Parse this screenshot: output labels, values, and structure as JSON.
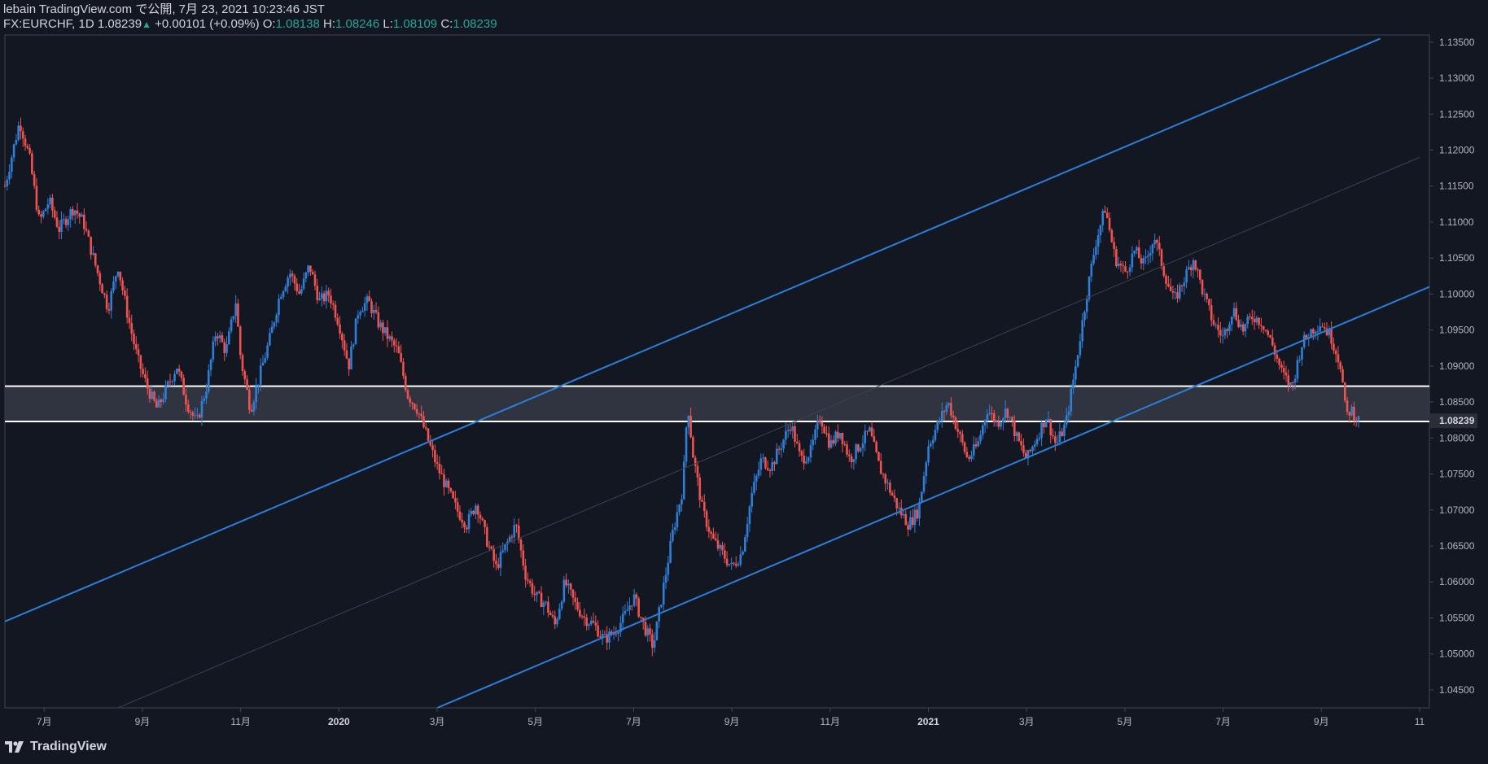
{
  "header": {
    "publisher": "lebain TradingView.com で公開, 7月 23, 2021 10:23:46 JST",
    "symbol_line": "FX:EURCHF, 1D 1.08239",
    "change": "+0.00101 (+0.09%)",
    "o_label": "O:",
    "o_value": "1.08138",
    "h_label": "H:",
    "h_value": "1.08246",
    "l_label": "L:",
    "l_value": "1.08109",
    "c_label": "C:",
    "c_value": "1.08239"
  },
  "footer": {
    "brand": "TradingView",
    "logo_icon": "tradingview-logo-icon"
  },
  "colors": {
    "background": "#131722",
    "up": "#2f7fd6",
    "down": "#ef5350",
    "trendline": "#2b7fd8",
    "zone": "#363a45",
    "zone_border": "#ffffff"
  },
  "chart_data": {
    "type": "candlestick",
    "symbol": "FX:EURCHF",
    "interval": "1D",
    "ylim": [
      1.0425,
      1.136
    ],
    "y_ticks": [
      "1.13500",
      "1.13000",
      "1.12500",
      "1.12000",
      "1.11500",
      "1.11000",
      "1.10500",
      "1.10000",
      "1.09500",
      "1.09000",
      "1.08500",
      "1.08000",
      "1.07500",
      "1.07000",
      "1.06500",
      "1.06000",
      "1.05500",
      "1.05000",
      "1.04500"
    ],
    "x_ticks": [
      {
        "label": "7月",
        "t": 0.3,
        "bold": false
      },
      {
        "label": "9月",
        "t": 2.3,
        "bold": false
      },
      {
        "label": "11月",
        "t": 4.3,
        "bold": false
      },
      {
        "label": "2020",
        "t": 6.3,
        "bold": true
      },
      {
        "label": "3月",
        "t": 8.3,
        "bold": false
      },
      {
        "label": "5月",
        "t": 10.3,
        "bold": false
      },
      {
        "label": "7月",
        "t": 12.3,
        "bold": false
      },
      {
        "label": "9月",
        "t": 14.3,
        "bold": false
      },
      {
        "label": "11月",
        "t": 16.3,
        "bold": false
      },
      {
        "label": "2021",
        "t": 18.3,
        "bold": true
      },
      {
        "label": "3月",
        "t": 20.3,
        "bold": false
      },
      {
        "label": "5月",
        "t": 22.3,
        "bold": false
      },
      {
        "label": "7月",
        "t": 24.3,
        "bold": false
      },
      {
        "label": "9月",
        "t": 26.3,
        "bold": false
      },
      {
        "label": "11",
        "t": 28.3,
        "bold": false
      }
    ],
    "x_range": [
      -0.5,
      28.5
    ],
    "last_price": "1.08239",
    "support_zone": {
      "lower": 1.0823,
      "upper": 1.0872
    },
    "channel": {
      "upper": [
        {
          "t": -0.5,
          "p": 1.0545
        },
        {
          "t": 27.5,
          "p": 1.1355
        }
      ],
      "lower": [
        {
          "t": 8.3,
          "p": 1.0425
        },
        {
          "t": 28.5,
          "p": 1.101
        }
      ],
      "middle": [
        {
          "t": 1.8,
          "p": 1.0425
        },
        {
          "t": 28.3,
          "p": 1.119
        }
      ]
    },
    "series_path": [
      {
        "t": -0.5,
        "p": 1.115
      },
      {
        "t": -0.3,
        "p": 1.121
      },
      {
        "t": -0.2,
        "p": 1.124
      },
      {
        "t": 0.0,
        "p": 1.119
      },
      {
        "t": 0.2,
        "p": 1.11
      },
      {
        "t": 0.4,
        "p": 1.113
      },
      {
        "t": 0.6,
        "p": 1.109
      },
      {
        "t": 0.9,
        "p": 1.112
      },
      {
        "t": 1.1,
        "p": 1.11
      },
      {
        "t": 1.3,
        "p": 1.105
      },
      {
        "t": 1.6,
        "p": 1.098
      },
      {
        "t": 1.8,
        "p": 1.104
      },
      {
        "t": 2.0,
        "p": 1.097
      },
      {
        "t": 2.2,
        "p": 1.091
      },
      {
        "t": 2.4,
        "p": 1.087
      },
      {
        "t": 2.6,
        "p": 1.084
      },
      {
        "t": 2.8,
        "p": 1.087
      },
      {
        "t": 3.0,
        "p": 1.09
      },
      {
        "t": 3.2,
        "p": 1.085
      },
      {
        "t": 3.4,
        "p": 1.082
      },
      {
        "t": 3.6,
        "p": 1.087
      },
      {
        "t": 3.8,
        "p": 1.095
      },
      {
        "t": 4.0,
        "p": 1.092
      },
      {
        "t": 4.2,
        "p": 1.099
      },
      {
        "t": 4.3,
        "p": 1.091
      },
      {
        "t": 4.5,
        "p": 1.084
      },
      {
        "t": 4.7,
        "p": 1.089
      },
      {
        "t": 4.9,
        "p": 1.094
      },
      {
        "t": 5.1,
        "p": 1.1
      },
      {
        "t": 5.3,
        "p": 1.103
      },
      {
        "t": 5.5,
        "p": 1.1
      },
      {
        "t": 5.7,
        "p": 1.104
      },
      {
        "t": 5.9,
        "p": 1.099
      },
      {
        "t": 6.1,
        "p": 1.1
      },
      {
        "t": 6.3,
        "p": 1.096
      },
      {
        "t": 6.5,
        "p": 1.09
      },
      {
        "t": 6.7,
        "p": 1.098
      },
      {
        "t": 6.9,
        "p": 1.099
      },
      {
        "t": 7.1,
        "p": 1.096
      },
      {
        "t": 7.3,
        "p": 1.094
      },
      {
        "t": 7.5,
        "p": 1.092
      },
      {
        "t": 7.7,
        "p": 1.086
      },
      {
        "t": 7.9,
        "p": 1.084
      },
      {
        "t": 8.1,
        "p": 1.08
      },
      {
        "t": 8.3,
        "p": 1.076
      },
      {
        "t": 8.5,
        "p": 1.073
      },
      {
        "t": 8.7,
        "p": 1.07
      },
      {
        "t": 8.9,
        "p": 1.068
      },
      {
        "t": 9.1,
        "p": 1.071
      },
      {
        "t": 9.3,
        "p": 1.066
      },
      {
        "t": 9.5,
        "p": 1.062
      },
      {
        "t": 9.7,
        "p": 1.065
      },
      {
        "t": 9.9,
        "p": 1.068
      },
      {
        "t": 10.1,
        "p": 1.061
      },
      {
        "t": 10.3,
        "p": 1.058
      },
      {
        "t": 10.5,
        "p": 1.057
      },
      {
        "t": 10.7,
        "p": 1.054
      },
      {
        "t": 10.9,
        "p": 1.06
      },
      {
        "t": 11.1,
        "p": 1.057
      },
      {
        "t": 11.3,
        "p": 1.055
      },
      {
        "t": 11.5,
        "p": 1.054
      },
      {
        "t": 11.7,
        "p": 1.052
      },
      {
        "t": 11.9,
        "p": 1.053
      },
      {
        "t": 12.1,
        "p": 1.055
      },
      {
        "t": 12.3,
        "p": 1.058
      },
      {
        "t": 12.5,
        "p": 1.054
      },
      {
        "t": 12.7,
        "p": 1.051
      },
      {
        "t": 12.9,
        "p": 1.059
      },
      {
        "t": 13.1,
        "p": 1.067
      },
      {
        "t": 13.3,
        "p": 1.073
      },
      {
        "t": 13.4,
        "p": 1.085
      },
      {
        "t": 13.5,
        "p": 1.078
      },
      {
        "t": 13.7,
        "p": 1.07
      },
      {
        "t": 13.9,
        "p": 1.066
      },
      {
        "t": 14.1,
        "p": 1.064
      },
      {
        "t": 14.3,
        "p": 1.062
      },
      {
        "t": 14.5,
        "p": 1.064
      },
      {
        "t": 14.7,
        "p": 1.072
      },
      {
        "t": 14.9,
        "p": 1.077
      },
      {
        "t": 15.1,
        "p": 1.076
      },
      {
        "t": 15.3,
        "p": 1.079
      },
      {
        "t": 15.5,
        "p": 1.082
      },
      {
        "t": 15.7,
        "p": 1.077
      },
      {
        "t": 15.9,
        "p": 1.078
      },
      {
        "t": 16.1,
        "p": 1.083
      },
      {
        "t": 16.3,
        "p": 1.079
      },
      {
        "t": 16.5,
        "p": 1.081
      },
      {
        "t": 16.7,
        "p": 1.077
      },
      {
        "t": 16.9,
        "p": 1.079
      },
      {
        "t": 17.1,
        "p": 1.081
      },
      {
        "t": 17.3,
        "p": 1.076
      },
      {
        "t": 17.5,
        "p": 1.073
      },
      {
        "t": 17.7,
        "p": 1.07
      },
      {
        "t": 17.9,
        "p": 1.068
      },
      {
        "t": 18.1,
        "p": 1.07
      },
      {
        "t": 18.3,
        "p": 1.079
      },
      {
        "t": 18.5,
        "p": 1.082
      },
      {
        "t": 18.7,
        "p": 1.085
      },
      {
        "t": 18.9,
        "p": 1.081
      },
      {
        "t": 19.1,
        "p": 1.077
      },
      {
        "t": 19.3,
        "p": 1.079
      },
      {
        "t": 19.5,
        "p": 1.084
      },
      {
        "t": 19.7,
        "p": 1.082
      },
      {
        "t": 19.9,
        "p": 1.084
      },
      {
        "t": 20.1,
        "p": 1.08
      },
      {
        "t": 20.3,
        "p": 1.077
      },
      {
        "t": 20.5,
        "p": 1.08
      },
      {
        "t": 20.7,
        "p": 1.083
      },
      {
        "t": 20.9,
        "p": 1.079
      },
      {
        "t": 21.1,
        "p": 1.082
      },
      {
        "t": 21.3,
        "p": 1.09
      },
      {
        "t": 21.5,
        "p": 1.099
      },
      {
        "t": 21.7,
        "p": 1.107
      },
      {
        "t": 21.9,
        "p": 1.112
      },
      {
        "t": 22.1,
        "p": 1.105
      },
      {
        "t": 22.3,
        "p": 1.103
      },
      {
        "t": 22.5,
        "p": 1.106
      },
      {
        "t": 22.7,
        "p": 1.104
      },
      {
        "t": 22.9,
        "p": 1.108
      },
      {
        "t": 23.1,
        "p": 1.103
      },
      {
        "t": 23.3,
        "p": 1.099
      },
      {
        "t": 23.5,
        "p": 1.102
      },
      {
        "t": 23.7,
        "p": 1.105
      },
      {
        "t": 23.9,
        "p": 1.1
      },
      {
        "t": 24.1,
        "p": 1.096
      },
      {
        "t": 24.3,
        "p": 1.094
      },
      {
        "t": 24.5,
        "p": 1.098
      },
      {
        "t": 24.7,
        "p": 1.095
      },
      {
        "t": 24.9,
        "p": 1.097
      },
      {
        "t": 25.1,
        "p": 1.096
      },
      {
        "t": 25.3,
        "p": 1.093
      },
      {
        "t": 25.5,
        "p": 1.089
      },
      {
        "t": 25.7,
        "p": 1.087
      },
      {
        "t": 25.9,
        "p": 1.093
      },
      {
        "t": 26.1,
        "p": 1.095
      },
      {
        "t": 26.3,
        "p": 1.096
      },
      {
        "t": 26.5,
        "p": 1.094
      },
      {
        "t": 26.7,
        "p": 1.09
      },
      {
        "t": 26.8,
        "p": 1.083
      },
      {
        "t": 26.9,
        "p": 1.084
      },
      {
        "t": 27.0,
        "p": 1.083
      },
      {
        "t": 27.1,
        "p": 1.082
      }
    ]
  }
}
